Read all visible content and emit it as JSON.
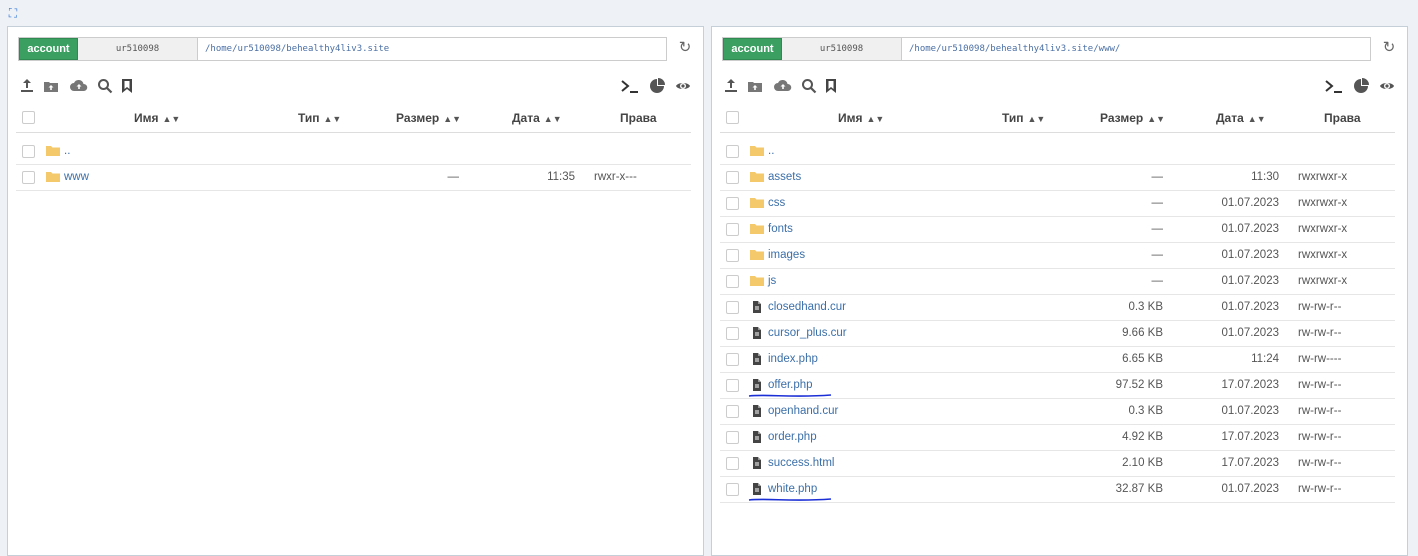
{
  "colors": {
    "account": "#3c9f62",
    "link": "#3b6fa8",
    "folder": "#f3c96b",
    "annotation": "#1b2fd6"
  },
  "left": {
    "account_label": "account",
    "user": "ur510098",
    "path": "/home/ur510098/behealthy4liv3.site",
    "headers": {
      "name": "Имя",
      "type": "Тип",
      "size": "Размер",
      "date": "Дата",
      "perms": "Права"
    },
    "rows": [
      {
        "kind": "folder",
        "name": "..",
        "size": "",
        "date": "",
        "perms": ""
      },
      {
        "kind": "folder",
        "name": "www",
        "size": "—",
        "date": "11:35",
        "perms": "rwxr-x---"
      }
    ]
  },
  "right": {
    "account_label": "account",
    "user": "ur510098",
    "path": "/home/ur510098/behealthy4liv3.site/www/",
    "headers": {
      "name": "Имя",
      "type": "Тип",
      "size": "Размер",
      "date": "Дата",
      "perms": "Права"
    },
    "rows": [
      {
        "kind": "folder",
        "name": "..",
        "size": "",
        "date": "",
        "perms": ""
      },
      {
        "kind": "folder",
        "name": "assets",
        "size": "—",
        "date": "11:30",
        "perms": "rwxrwxr-x"
      },
      {
        "kind": "folder",
        "name": "css",
        "size": "—",
        "date": "01.07.2023",
        "perms": "rwxrwxr-x"
      },
      {
        "kind": "folder",
        "name": "fonts",
        "size": "—",
        "date": "01.07.2023",
        "perms": "rwxrwxr-x"
      },
      {
        "kind": "folder",
        "name": "images",
        "size": "—",
        "date": "01.07.2023",
        "perms": "rwxrwxr-x"
      },
      {
        "kind": "folder",
        "name": "js",
        "size": "—",
        "date": "01.07.2023",
        "perms": "rwxrwxr-x"
      },
      {
        "kind": "file",
        "name": "closedhand.cur",
        "size": "0.3 KB",
        "date": "01.07.2023",
        "perms": "rw-rw-r--"
      },
      {
        "kind": "file",
        "name": "cursor_plus.cur",
        "size": "9.66 KB",
        "date": "01.07.2023",
        "perms": "rw-rw-r--"
      },
      {
        "kind": "file",
        "name": "index.php",
        "size": "6.65 KB",
        "date": "11:24",
        "perms": "rw-rw----"
      },
      {
        "kind": "file",
        "name": "offer.php",
        "size": "97.52 KB",
        "date": "17.07.2023",
        "perms": "rw-rw-r--",
        "underlined": true
      },
      {
        "kind": "file",
        "name": "openhand.cur",
        "size": "0.3 KB",
        "date": "01.07.2023",
        "perms": "rw-rw-r--"
      },
      {
        "kind": "file",
        "name": "order.php",
        "size": "4.92 KB",
        "date": "17.07.2023",
        "perms": "rw-rw-r--"
      },
      {
        "kind": "file",
        "name": "success.html",
        "size": "2.10 KB",
        "date": "17.07.2023",
        "perms": "rw-rw-r--"
      },
      {
        "kind": "file",
        "name": "white.php",
        "size": "32.87 KB",
        "date": "01.07.2023",
        "perms": "rw-rw-r--",
        "underlined": true
      }
    ]
  },
  "toolbar_icons": [
    "upload-icon",
    "upload-folder-icon",
    "cloud-upload-icon",
    "search-icon",
    "bookmark-icon",
    "terminal-icon",
    "disk-usage-icon",
    "eye-icon"
  ]
}
